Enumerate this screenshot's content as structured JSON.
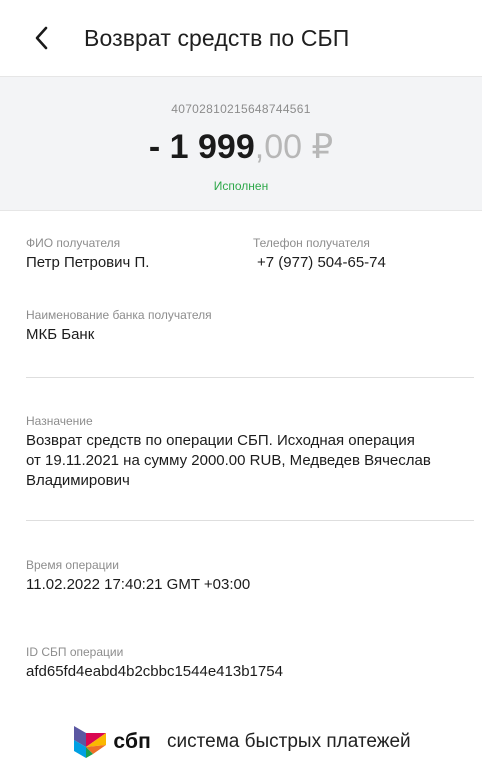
{
  "header": {
    "title": "Возврат средств по СБП",
    "back_icon": "chevron-left-icon"
  },
  "summary": {
    "account": "40702810215648744561",
    "amount_int": "- 1 999",
    "amount_frac": ",00",
    "currency": "₽",
    "status": "Исполнен",
    "status_color": "#2ea84a"
  },
  "details": {
    "recipient_name_label": "ФИО получателя",
    "recipient_name": "Петр Петрович П.",
    "recipient_phone_label": "Телефон получателя",
    "recipient_phone": "+7 (977) 504-65-74",
    "bank_label": "Наименование банка получателя",
    "bank": "МКБ Банк",
    "purpose_label": "Назначение",
    "purpose_line1": "Возврат средств по операции СБП. Исходная операция",
    "purpose_line2": "от 19.11.2021 на сумму 2000.00 RUB, Медведев Вячеслав",
    "purpose_line3": "Владимирович",
    "time_label": "Время операции",
    "time": "11.02.2022 17:40:21 GMT +03:00",
    "sbp_id_label": "ID СБП операции",
    "sbp_id": "afd65fd4eabd4b2cbbc1544e413b1754"
  },
  "footer": {
    "logo_word": "сбп",
    "tagline": "система быстрых платежей"
  }
}
